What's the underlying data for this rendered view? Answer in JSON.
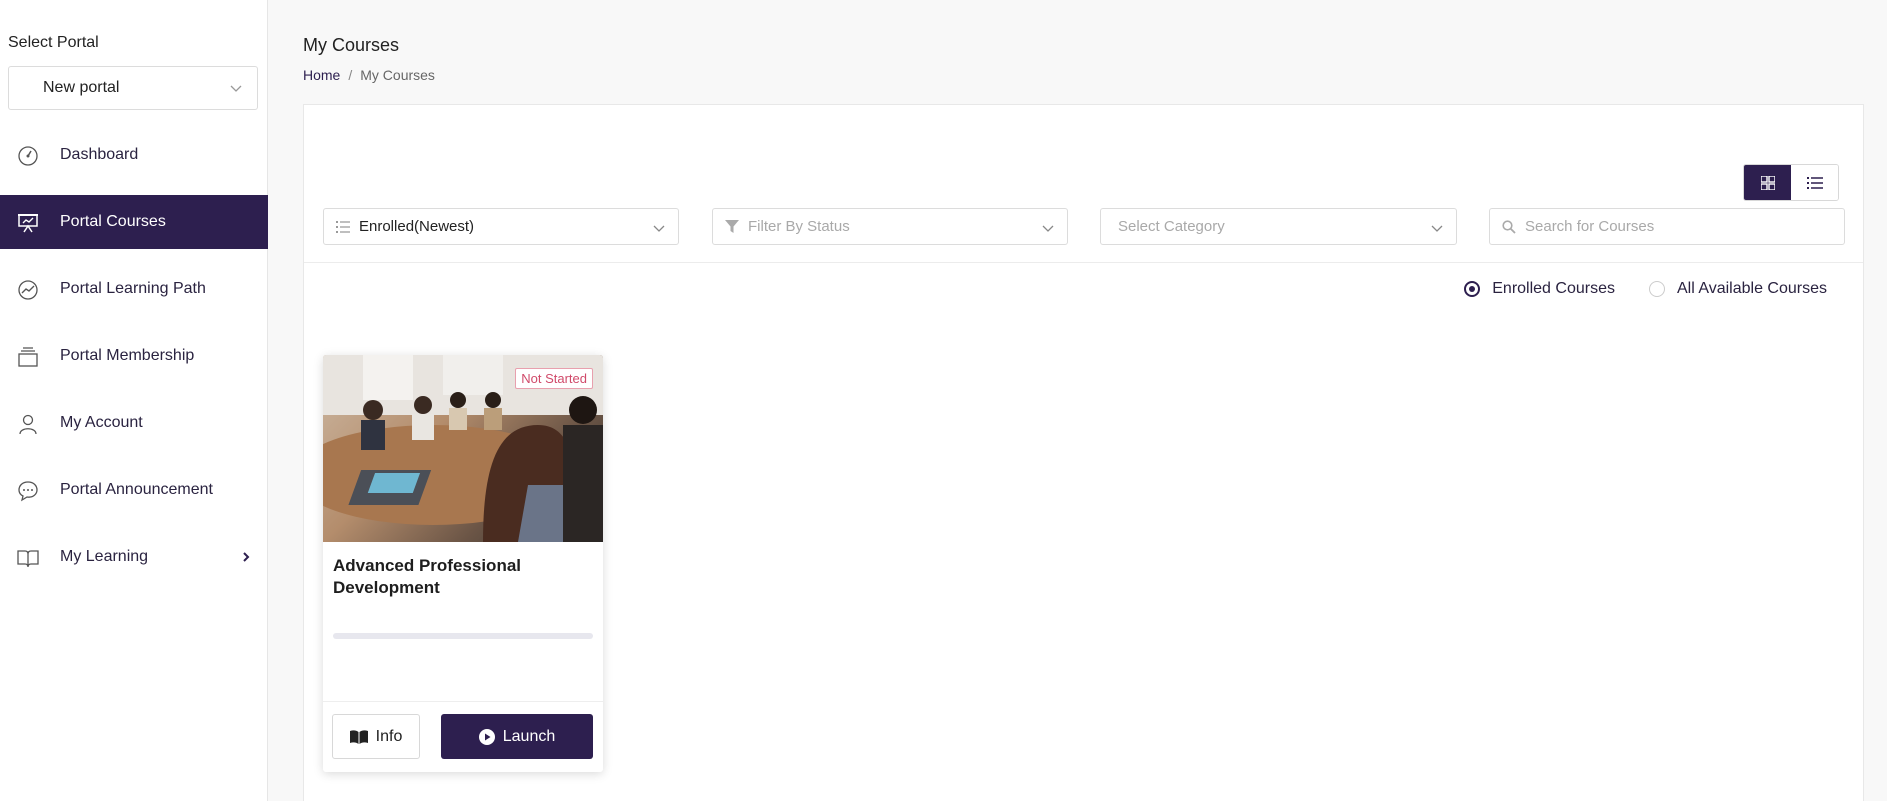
{
  "sidebar": {
    "portal_label": "Select Portal",
    "portal_value": "New portal",
    "items": [
      {
        "label": "Dashboard",
        "icon": "gauge-icon"
      },
      {
        "label": "Portal Courses",
        "icon": "presentation-board-icon",
        "active": true
      },
      {
        "label": "Portal Learning Path",
        "icon": "chart-circle-icon"
      },
      {
        "label": "Portal Membership",
        "icon": "layers-icon"
      },
      {
        "label": "My Account",
        "icon": "user-icon"
      },
      {
        "label": "Portal Announcement",
        "icon": "chat-bubble-icon"
      },
      {
        "label": "My Learning",
        "icon": "open-book-icon"
      }
    ]
  },
  "header": {
    "title": "My Courses",
    "breadcrumb": {
      "home": "Home",
      "separator": "/",
      "current": "My Courses"
    }
  },
  "filters": {
    "sort_value": "Enrolled(Newest)",
    "status_placeholder": "Filter By Status",
    "category_placeholder": "Select Category",
    "search_placeholder": "Search for Courses"
  },
  "view_mode": "grid",
  "radios": {
    "enrolled": "Enrolled Courses",
    "all": "All Available Courses",
    "selected": "enrolled"
  },
  "course": {
    "title": "Advanced Professional Development",
    "status": "Not Started",
    "progress": 0,
    "info_label": "Info",
    "launch_label": "Launch"
  },
  "colors": {
    "brand": "#2d1f4f",
    "status_badge": "#d04a6a"
  }
}
